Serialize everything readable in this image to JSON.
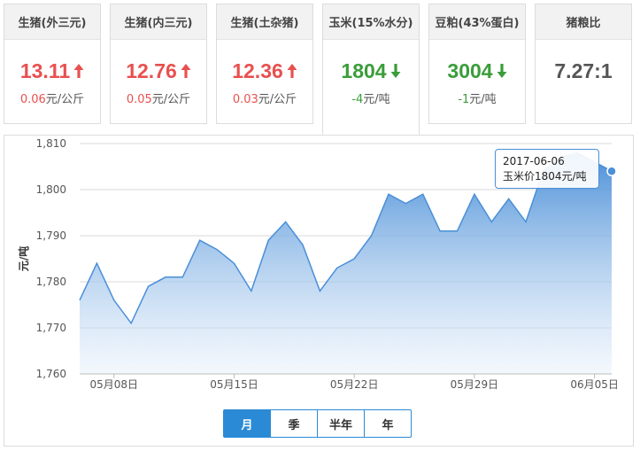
{
  "cards": [
    {
      "title": "生猪(外三元)",
      "price": "13.11",
      "change_value": "0.06",
      "change_unit": "元/公斤",
      "trend": "up"
    },
    {
      "title": "生猪(内三元)",
      "price": "12.76",
      "change_value": "0.05",
      "change_unit": "元/公斤",
      "trend": "up"
    },
    {
      "title": "生猪(土杂猪)",
      "price": "12.36",
      "change_value": "0.03",
      "change_unit": "元/公斤",
      "trend": "up"
    },
    {
      "title": "玉米(15%水分)",
      "price": "1804",
      "change_value": "-4",
      "change_unit": "元/吨",
      "trend": "down"
    },
    {
      "title": "豆粕(43%蛋白)",
      "price": "3004",
      "change_value": "-1",
      "change_unit": "元/吨",
      "trend": "down"
    },
    {
      "title": "猪粮比",
      "price": "7.27:1",
      "change_value": "",
      "change_unit": "",
      "trend": "none"
    }
  ],
  "tooltip": {
    "date": "2017-06-06",
    "label": "玉米价1804元/吨"
  },
  "range_tabs": [
    {
      "label": "月",
      "selected": true
    },
    {
      "label": "季",
      "selected": false
    },
    {
      "label": "半年",
      "selected": false
    },
    {
      "label": "年",
      "selected": false
    }
  ],
  "colors": {
    "up": "#e8504f",
    "down": "#3a9d3a",
    "line": "#4a8fd8",
    "accent": "#2a8ad6"
  },
  "chart_data": {
    "type": "area",
    "ylabel": "元/吨",
    "ylim": [
      1760,
      1810
    ],
    "yticks": [
      1760,
      1770,
      1780,
      1790,
      1800,
      1810
    ],
    "ytick_labels": [
      "1,760",
      "1,770",
      "1,780",
      "1,790",
      "1,800",
      "1,810"
    ],
    "x_tick_labels": [
      {
        "index": 2,
        "label": "05月08日"
      },
      {
        "index": 9,
        "label": "05月15日"
      },
      {
        "index": 16,
        "label": "05月22日"
      },
      {
        "index": 23,
        "label": "05月29日"
      },
      {
        "index": 30,
        "label": "06月05日"
      }
    ],
    "grid": true,
    "series": [
      {
        "values": [
          1776,
          1784,
          1776,
          1771,
          1779,
          1781,
          1781,
          1789,
          1787,
          1784,
          1778,
          1789,
          1793,
          1788,
          1778,
          1783,
          1785,
          1790,
          1799,
          1797,
          1799,
          1791,
          1791,
          1799,
          1793,
          1798,
          1793,
          1804,
          1807,
          1808,
          1806,
          1804
        ],
        "highlight_index": 31
      }
    ]
  }
}
